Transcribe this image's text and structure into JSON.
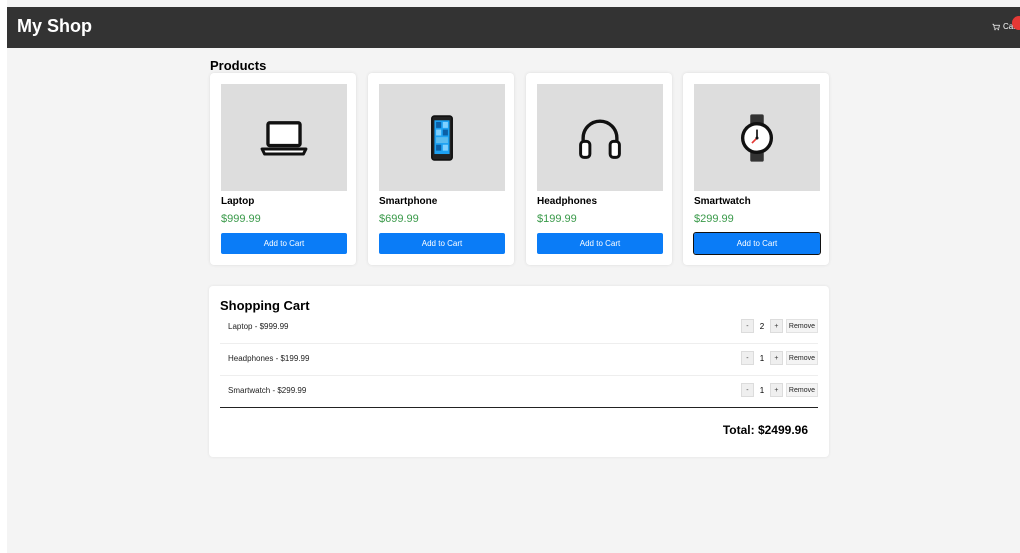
{
  "header": {
    "brand": "My Shop",
    "cart_label": "Cart",
    "cart_icon": "cart-icon"
  },
  "products_section": {
    "title": "Products",
    "items": [
      {
        "name": "Laptop",
        "price": "$999.99",
        "button": "Add to Cart",
        "icon": "laptop-icon"
      },
      {
        "name": "Smartphone",
        "price": "$699.99",
        "button": "Add to Cart",
        "icon": "smartphone-icon"
      },
      {
        "name": "Headphones",
        "price": "$199.99",
        "button": "Add to Cart",
        "icon": "headphones-icon"
      },
      {
        "name": "Smartwatch",
        "price": "$299.99",
        "button": "Add to Cart",
        "icon": "smartwatch-icon"
      }
    ]
  },
  "cart": {
    "title": "Shopping Cart",
    "rows": [
      {
        "label": "Laptop - $999.99",
        "qty": "2",
        "minus": "-",
        "plus": "+",
        "remove": "Remove"
      },
      {
        "label": "Headphones - $199.99",
        "qty": "1",
        "minus": "-",
        "plus": "+",
        "remove": "Remove"
      },
      {
        "label": "Smartwatch - $299.99",
        "qty": "1",
        "minus": "-",
        "plus": "+",
        "remove": "Remove"
      }
    ],
    "total": "Total: $2499.96"
  },
  "colors": {
    "header_bg": "#333333",
    "button_bg": "#0a7cf7",
    "price": "#3a9a4a",
    "badge": "#e53935",
    "page_bg": "#f4f4f4"
  }
}
